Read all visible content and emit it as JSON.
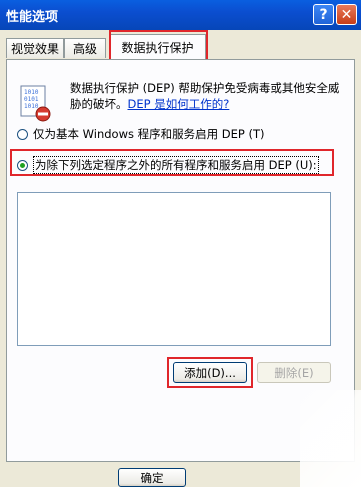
{
  "window": {
    "title": "性能选项",
    "help_glyph": "?",
    "close_glyph": "✕"
  },
  "tabs": [
    {
      "label": "视觉效果"
    },
    {
      "label": "高级"
    },
    {
      "label": "数据执行保护"
    }
  ],
  "dep": {
    "description": "数据执行保护 (DEP) 帮助保护免受病毒或其他安全威胁的破坏。",
    "link": "DEP 是如何工作的?",
    "option1": "仅为基本 Windows 程序和服务启用 DEP (T)",
    "option2": "为除下列选定程序之外的所有程序和服务启用 DEP (U):",
    "selected_option": 2
  },
  "buttons": {
    "add": "添加(D)...",
    "remove": "删除(E)",
    "ok": "确定"
  },
  "colors": {
    "highlight": "#e0262b",
    "titlebar": "#0b4ed0"
  }
}
